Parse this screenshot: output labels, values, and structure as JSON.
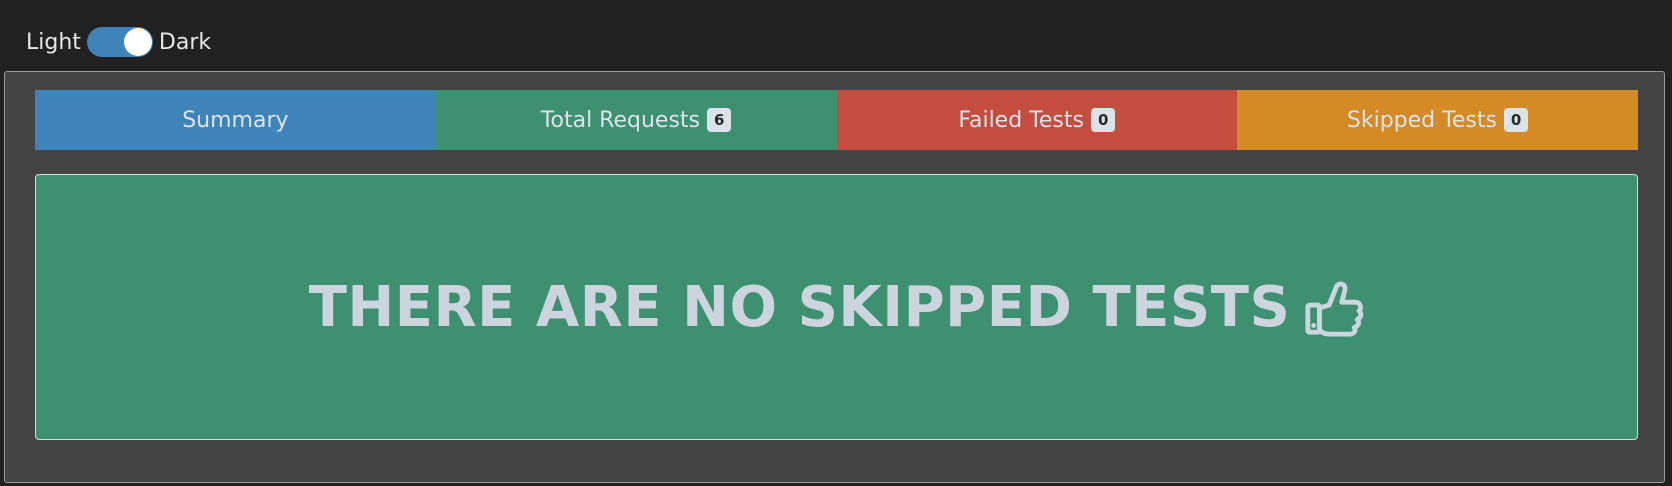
{
  "theme_toggle": {
    "light_label": "Light",
    "dark_label": "Dark",
    "state": "dark"
  },
  "tabs": [
    {
      "label": "Summary",
      "badge": null,
      "color": "#3f84b9"
    },
    {
      "label": "Total Requests",
      "badge": "6",
      "color": "#3d9170"
    },
    {
      "label": "Failed Tests",
      "badge": "0",
      "color": "#c44d40"
    },
    {
      "label": "Skipped Tests",
      "badge": "0",
      "color": "#d48a25"
    }
  ],
  "message": {
    "text": "THERE ARE NO SKIPPED TESTS",
    "icon": "thumbs-up-icon"
  },
  "colors": {
    "page_background": "#212121",
    "panel_background": "#444444",
    "success": "#3d9170"
  }
}
